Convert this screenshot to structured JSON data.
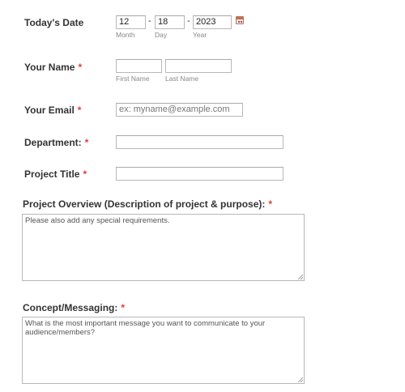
{
  "date": {
    "label": "Today's Date",
    "month": "12",
    "day": "18",
    "year": "2023",
    "separator": "-",
    "month_label": "Month",
    "day_label": "Day",
    "year_label": "Year"
  },
  "name": {
    "label": "Your Name",
    "required": "*",
    "first_label": "First Name",
    "last_label": "Last Name"
  },
  "email": {
    "label": "Your Email",
    "required": "*",
    "placeholder": "ex: myname@example.com"
  },
  "department": {
    "label": "Department:",
    "required": "*"
  },
  "project_title": {
    "label": "Project Title",
    "required": "*"
  },
  "overview": {
    "label": "Project Overview (Description of project & purpose):",
    "required": "*",
    "placeholder": "Please also add any special requirements."
  },
  "concept": {
    "label": "Concept/Messaging:",
    "required": "*",
    "placeholder": "What is the most important message you want to communicate to your audience/members?"
  },
  "icons": {
    "calendar": "calendar-icon",
    "resize": "resize-grip-icon"
  }
}
